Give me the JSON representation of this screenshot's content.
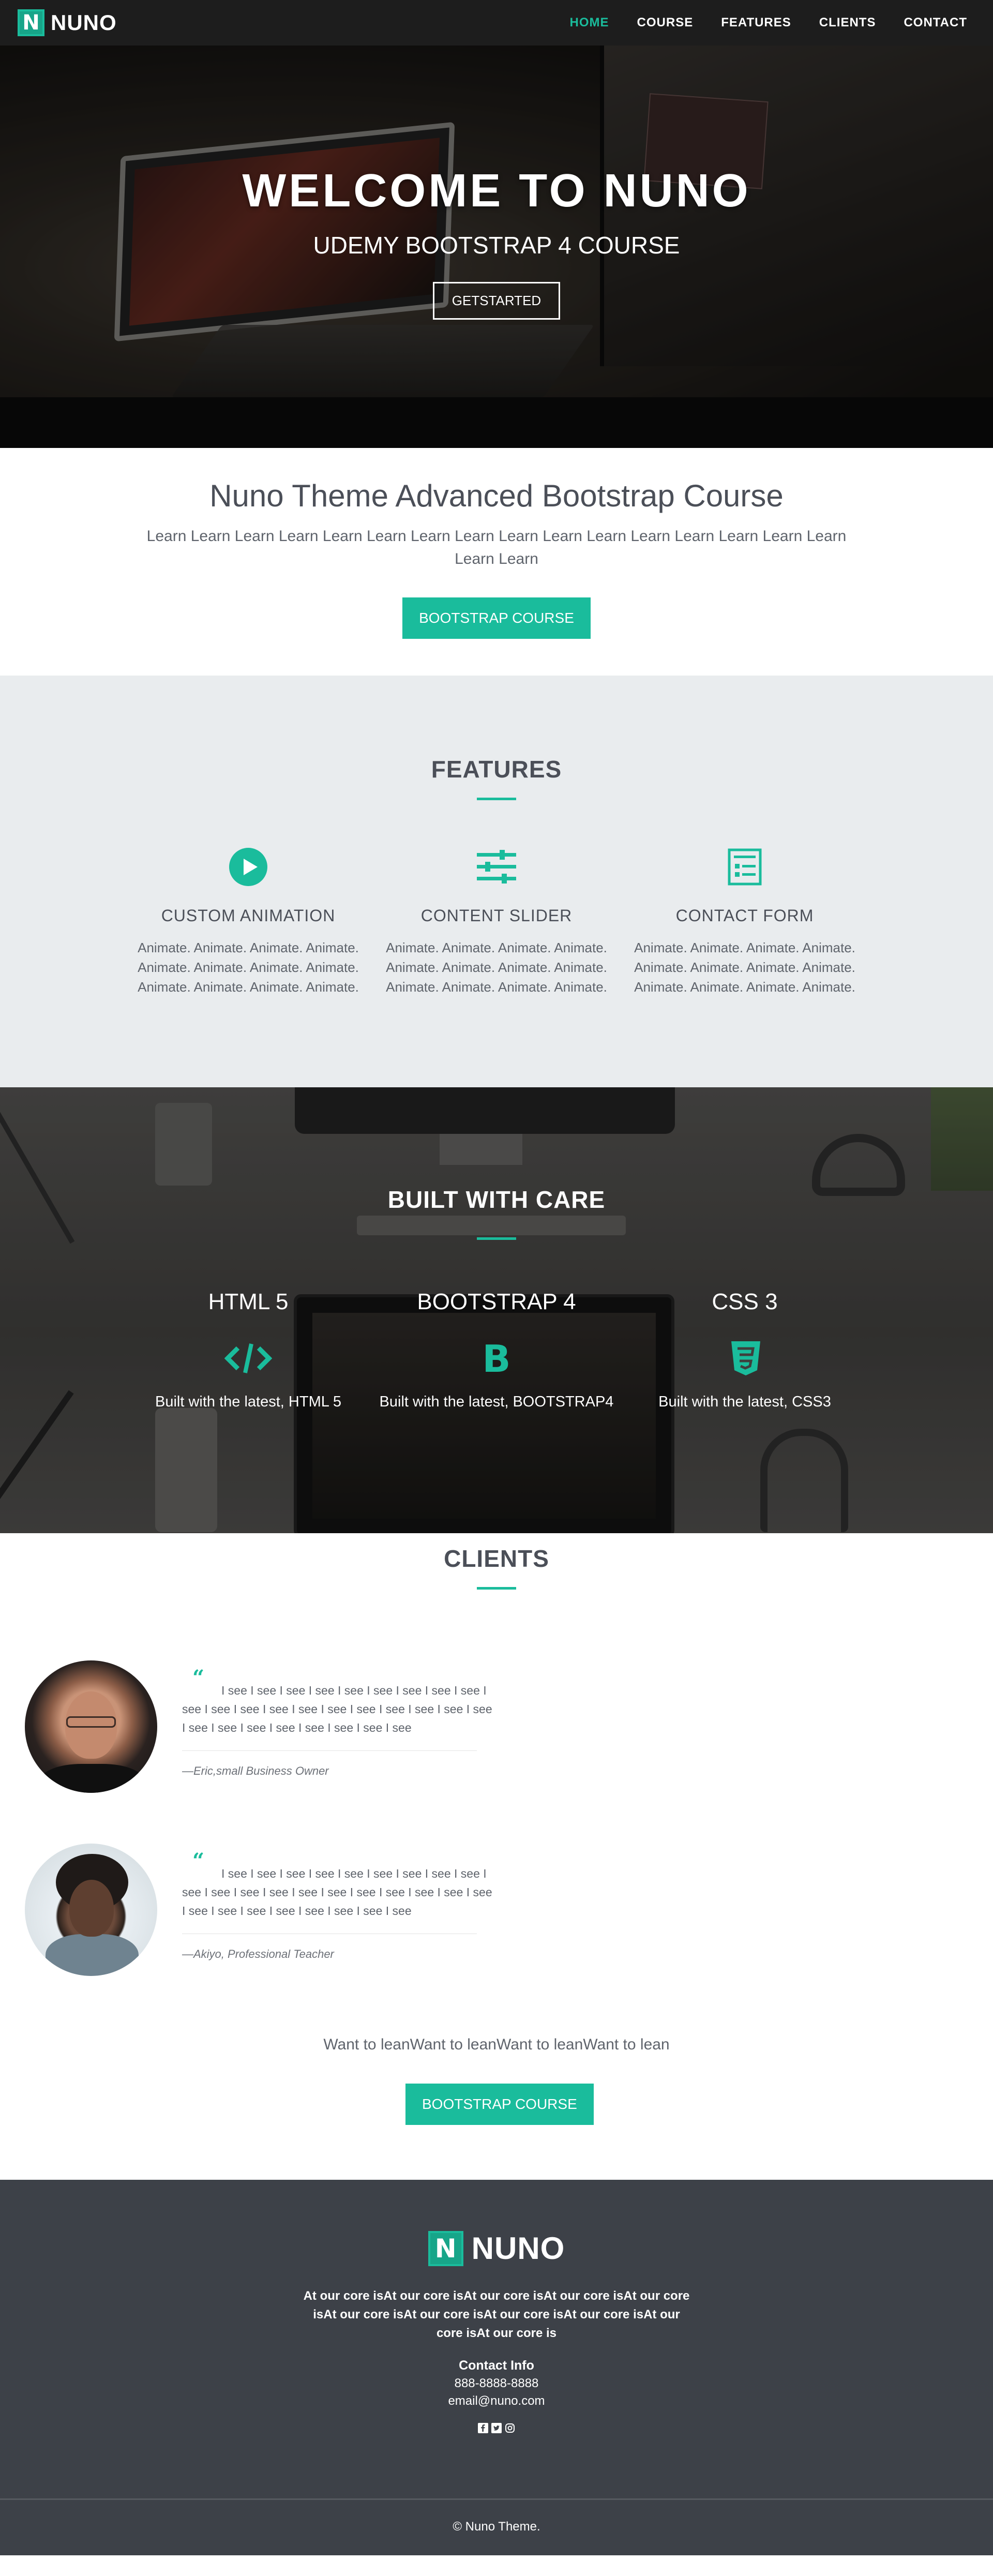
{
  "colors": {
    "accent": "#1abc9c",
    "dark": "#3d4148",
    "nav": "#1d1d1d",
    "features_bg": "#e9ecee"
  },
  "nav": {
    "logo_letter": "N",
    "brand": "NUNO",
    "links": [
      {
        "label": "HOME",
        "active": true
      },
      {
        "label": "COURSE",
        "active": false
      },
      {
        "label": "FEATURES",
        "active": false
      },
      {
        "label": "CLIENTS",
        "active": false
      },
      {
        "label": "CONTACT",
        "active": false
      }
    ]
  },
  "hero": {
    "title": "WELCOME TO NUNO",
    "subtitle": "UDEMY BOOTSTRAP 4 COURSE",
    "button": "GETSTARTED"
  },
  "intro": {
    "title": "Nuno Theme Advanced Bootstrap Course",
    "text": "Learn Learn Learn Learn Learn Learn Learn Learn Learn Learn Learn Learn Learn Learn Learn Learn Learn Learn",
    "button": "BOOTSTRAP COURSE"
  },
  "features": {
    "title": "FEATURES",
    "items": [
      {
        "icon": "play-circle-icon",
        "title": "CUSTOM ANIMATION",
        "text": "Animate. Animate. Animate. Animate. Animate. Animate. Animate. Animate. Animate. Animate. Animate. Animate."
      },
      {
        "icon": "sliders-icon",
        "title": "CONTENT SLIDER",
        "text": "Animate. Animate. Animate. Animate. Animate. Animate. Animate. Animate. Animate. Animate. Animate. Animate."
      },
      {
        "icon": "form-icon",
        "title": "CONTACT FORM",
        "text": "Animate. Animate. Animate. Animate. Animate. Animate. Animate. Animate. Animate. Animate. Animate. Animate."
      }
    ]
  },
  "built": {
    "title": "BUILT WITH CARE",
    "items": [
      {
        "icon": "code-icon",
        "title": "HTML 5",
        "text": "Built with the latest, HTML 5"
      },
      {
        "icon": "bootstrap-icon",
        "title": "BOOTSTRAP 4",
        "text": "Built with the latest, BOOTSTRAP4"
      },
      {
        "icon": "css3-icon",
        "title": "CSS 3",
        "text": "Built with the latest, CSS3"
      }
    ]
  },
  "clients": {
    "title": "CLIENTS",
    "testimonials": [
      {
        "text": "I see I see I see I see I see I see I see I see I see I see I see I see I see I see I see I see I see I see I see I see I see I see I see I see I see I see I see I see",
        "author": "—Eric,small Business Owner"
      },
      {
        "text": "I see I see I see I see I see I see I see I see I see I see I see I see I see I see I see I see I see I see I see I see I see I see I see I see I see I see I see I see",
        "author": "—Akiyo, Professional Teacher"
      }
    ],
    "cta_text": "Want to leanWant to leanWant to leanWant to lean",
    "cta_button": "BOOTSTRAP COURSE"
  },
  "footer": {
    "logo_letter": "N",
    "brand": "NUNO",
    "about": "At our core isAt our core isAt our core isAt our core isAt our core isAt our core isAt our core isAt our core isAt our core isAt our core isAt our core is",
    "contact_title": "Contact Info",
    "phone": "888-8888-8888",
    "email": "email@nuno.com",
    "socials": [
      "facebook-icon",
      "twitter-icon",
      "instagram-icon"
    ],
    "copyright": "© Nuno Theme."
  }
}
